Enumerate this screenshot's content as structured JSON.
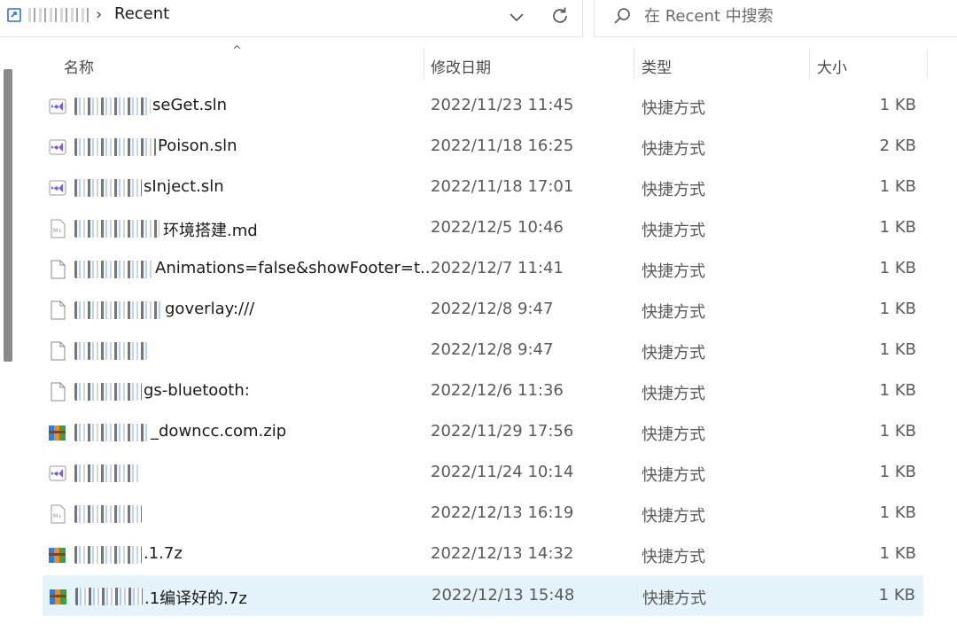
{
  "address": {
    "current_folder": "Recent",
    "separator": "›"
  },
  "search": {
    "placeholder": "在 Recent 中搜索"
  },
  "columns": {
    "name": "名称",
    "modified": "修改日期",
    "type": "类型",
    "size": "大小",
    "sort_indicator": "^"
  },
  "files": [
    {
      "name": "seGet.sln",
      "date": "2022/11/23 11:45",
      "type": "快捷方式",
      "size": "1 KB",
      "icon": "visual-studio-sln-icon"
    },
    {
      "name": "Poison.sln",
      "date": "2022/11/18 16:25",
      "type": "快捷方式",
      "size": "2 KB",
      "icon": "visual-studio-sln-icon"
    },
    {
      "name": "sInject.sln",
      "date": "2022/11/18 17:01",
      "type": "快捷方式",
      "size": "1 KB",
      "icon": "visual-studio-sln-icon"
    },
    {
      "name": "环境搭建.md",
      "date": "2022/12/5 10:46",
      "type": "快捷方式",
      "size": "1 KB",
      "icon": "markdown-file-icon"
    },
    {
      "name": "Animations=false&showFooter=t...",
      "date": "2022/12/7 11:41",
      "type": "快捷方式",
      "size": "1 KB",
      "icon": "blank-file-icon"
    },
    {
      "name": "goverlay:///",
      "date": "2022/12/8 9:47",
      "type": "快捷方式",
      "size": "1 KB",
      "icon": "blank-file-icon"
    },
    {
      "name": "",
      "date": "2022/12/8 9:47",
      "type": "快捷方式",
      "size": "1 KB",
      "icon": "blank-file-icon"
    },
    {
      "name": "gs-bluetooth:",
      "date": "2022/12/6 11:36",
      "type": "快捷方式",
      "size": "1 KB",
      "icon": "blank-file-icon"
    },
    {
      "name": "_downcc.com.zip",
      "date": "2022/11/29 17:56",
      "type": "快捷方式",
      "size": "1 KB",
      "icon": "winrar-archive-icon"
    },
    {
      "name": "",
      "date": "2022/11/24 10:14",
      "type": "快捷方式",
      "size": "1 KB",
      "icon": "visual-studio-sln-icon"
    },
    {
      "name": "",
      "date": "2022/12/13 16:19",
      "type": "快捷方式",
      "size": "1 KB",
      "icon": "markdown-file-icon"
    },
    {
      "name": ".1.7z",
      "date": "2022/12/13 14:32",
      "type": "快捷方式",
      "size": "1 KB",
      "icon": "winrar-archive-icon"
    },
    {
      "name": ".1编译好的.7z",
      "date": "2022/12/13 15:48",
      "type": "快捷方式",
      "size": "1 KB",
      "icon": "winrar-archive-icon"
    }
  ],
  "colors": {
    "selected_row": "#e5f3fb",
    "vs_purple": "#7b5bd6",
    "winrar_blue": "#2f7fd9",
    "winrar_orange": "#e98b2a"
  }
}
